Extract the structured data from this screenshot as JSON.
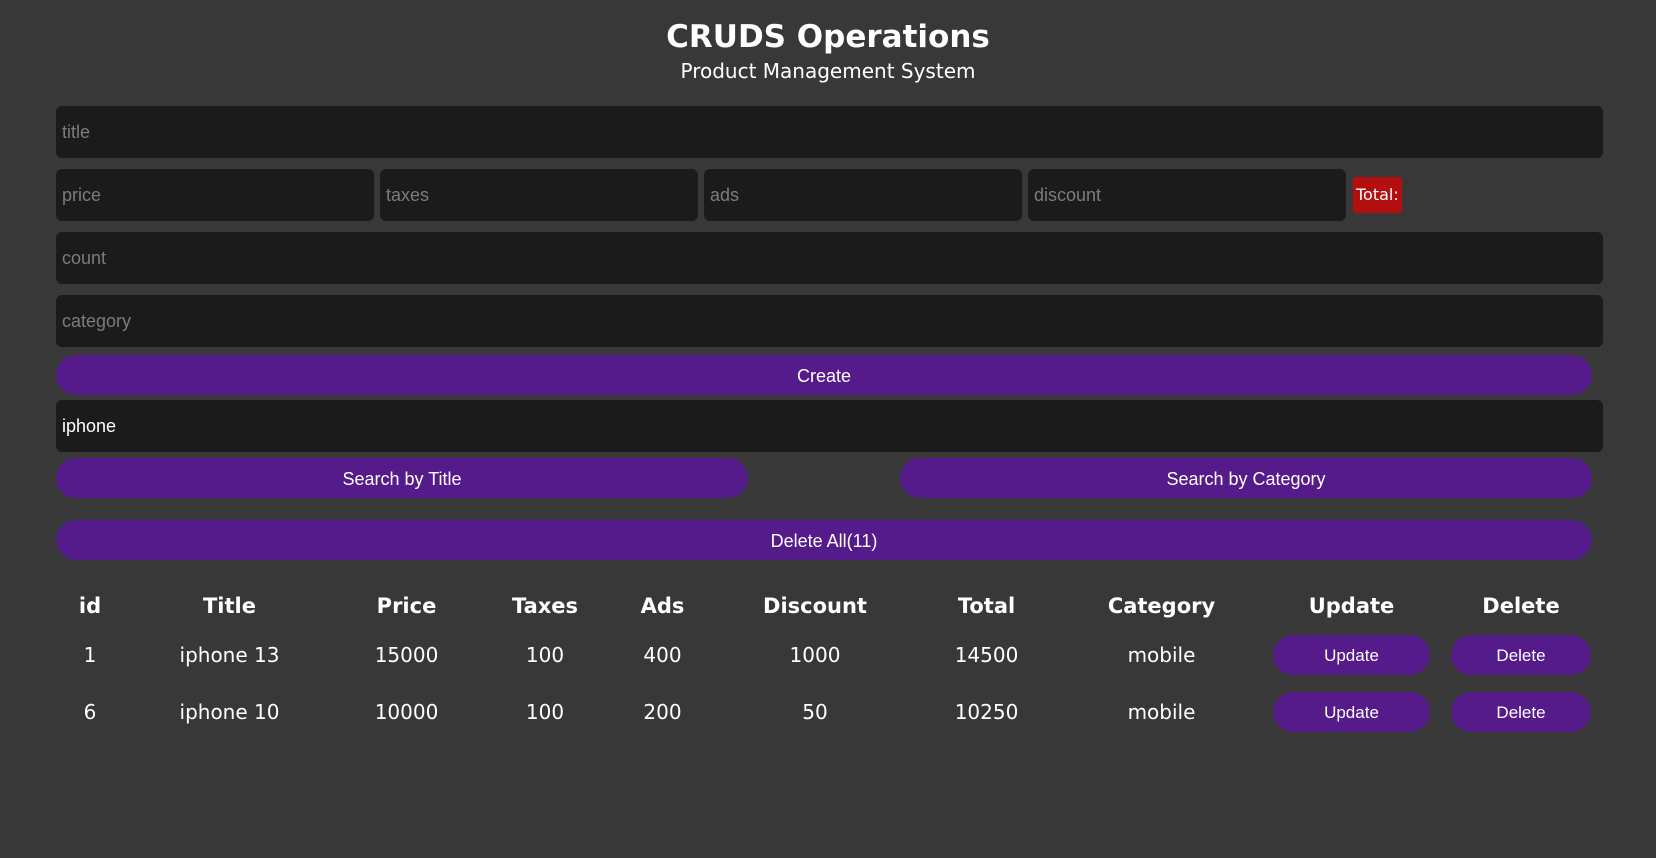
{
  "header": {
    "title": "CRUDS Operations",
    "subtitle": "Product Management System"
  },
  "form": {
    "title_placeholder": "title",
    "price_placeholder": "price",
    "taxes_placeholder": "taxes",
    "ads_placeholder": "ads",
    "discount_placeholder": "discount",
    "total_label": "Total:",
    "count_placeholder": "count",
    "category_placeholder": "category",
    "create_label": "Create"
  },
  "search": {
    "value": "iphone",
    "by_title_label": "Search by Title",
    "by_category_label": "Search by Category"
  },
  "delete_all_label": "Delete All(11)",
  "table": {
    "headers": [
      "id",
      "Title",
      "Price",
      "Taxes",
      "Ads",
      "Discount",
      "Total",
      "Category",
      "Update",
      "Delete"
    ],
    "rows": [
      {
        "id": "1",
        "title": "iphone 13",
        "price": "15000",
        "taxes": "100",
        "ads": "400",
        "discount": "1000",
        "total": "14500",
        "category": "mobile",
        "update_label": "Update",
        "delete_label": "Delete"
      },
      {
        "id": "6",
        "title": "iphone 10",
        "price": "10000",
        "taxes": "100",
        "ads": "200",
        "discount": "50",
        "total": "10250",
        "category": "mobile",
        "update_label": "Update",
        "delete_label": "Delete"
      }
    ]
  },
  "colors": {
    "background": "#383838",
    "input_background": "#1b1b1b",
    "button_purple": "#551b8b",
    "total_red": "#b30f0f"
  }
}
